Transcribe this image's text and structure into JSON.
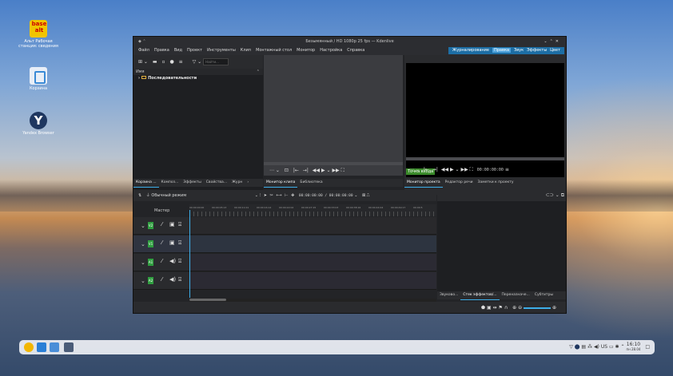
{
  "desktop": {
    "icons": [
      {
        "label": "Альт Рабочая станция: сведения",
        "icon": "alt-logo-icon",
        "logo": "base alt"
      },
      {
        "label": "Корзина",
        "icon": "trash-icon"
      },
      {
        "label": "Yandex Browser",
        "icon": "yandex-browser-icon"
      }
    ]
  },
  "window": {
    "title": "Безымянный / HD 1080p 25 fps — Kdenlive",
    "menu": [
      "Файл",
      "Правка",
      "Вид",
      "Проект",
      "Инструменты",
      "Клип",
      "Монтажный стол",
      "Монитор",
      "Настройка",
      "Справка"
    ],
    "layouts": [
      "Журналирование",
      "Правка",
      "Звук",
      "Эффекты",
      "Цвет"
    ],
    "active_layout": "Правка",
    "bin": {
      "search_placeholder": "Найти...",
      "column_header": "Имя",
      "items": [
        "Последовательности"
      ]
    },
    "left_tabs": [
      "Корзина ...",
      "Композ...",
      "Эффекты",
      "Свойства...",
      "Журн"
    ],
    "clip_monitor_tabs": [
      "Монитор клипа",
      "Библиотека"
    ],
    "project_monitor_tabs": [
      "Монитор проекта",
      "Редактор речи",
      "Заметки к проекту"
    ],
    "in_point_label": "Точка входа",
    "project_timecode": "00:00:00:00",
    "timeline": {
      "mode": "Обычный режим",
      "timecode": "00:00:00:00 / 00:00:00:00",
      "master_label": "Мастер",
      "ruler_labels": [
        "00:00:00:00",
        "00:00:05:13",
        "00:00:11:01",
        "00:00:16:14",
        "00:00:22:02",
        "00:00:27:15",
        "00:00:33:03",
        "00:00:38:16",
        "00:00:44:04",
        "00:00:49:17",
        "00:00:5"
      ],
      "tracks": [
        {
          "type": "video",
          "label": "V2"
        },
        {
          "type": "video",
          "label": "V1"
        },
        {
          "type": "audio",
          "label": "A1"
        },
        {
          "type": "audio",
          "label": "A2"
        }
      ]
    },
    "effect_tabs": [
      "Звуково...",
      "Стек эффектов/...",
      "Переназначе...",
      "Субтитры"
    ]
  },
  "taskbar": {
    "keyboard_layout": "US",
    "time": "16:10",
    "date": "пн 28.04"
  }
}
